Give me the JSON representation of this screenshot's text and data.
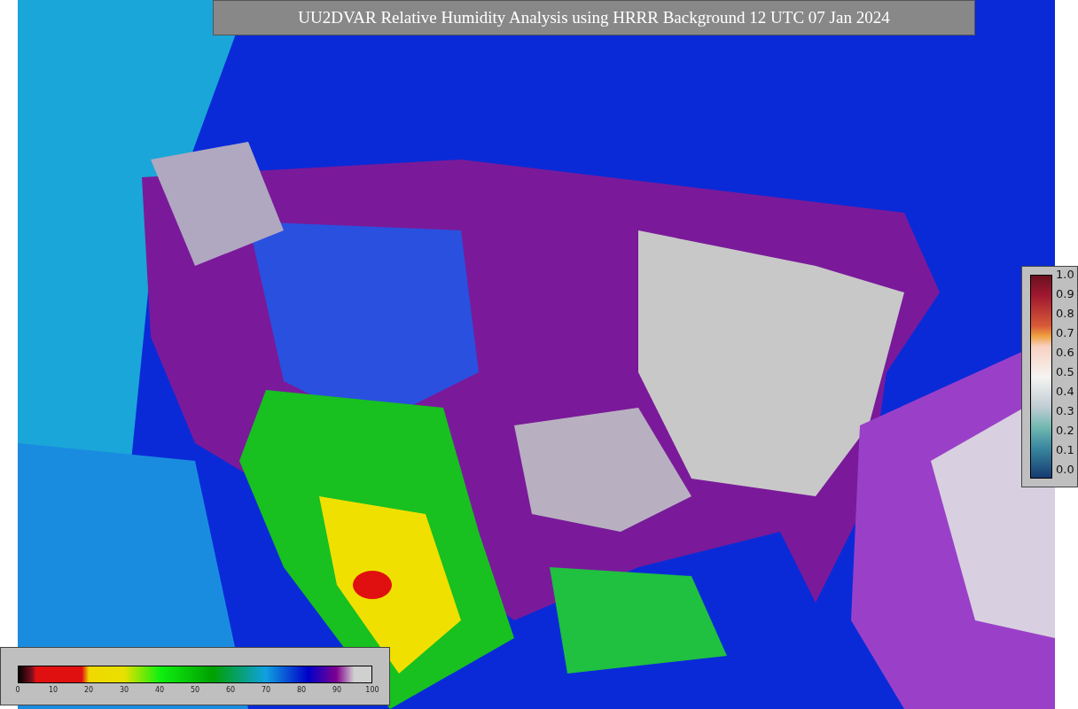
{
  "title": "UU2DVAR Relative Humidity Analysis using HRRR Background 12 UTC 07 Jan 2024",
  "colorbar_bottom": {
    "ticks": [
      "0",
      "10",
      "20",
      "30",
      "40",
      "50",
      "60",
      "70",
      "80",
      "90",
      "100"
    ]
  },
  "colorbar_right": {
    "ticks": [
      "1.0",
      "0.9",
      "0.8",
      "0.7",
      "0.6",
      "0.5",
      "0.4",
      "0.3",
      "0.2",
      "0.1",
      "0.0"
    ]
  }
}
